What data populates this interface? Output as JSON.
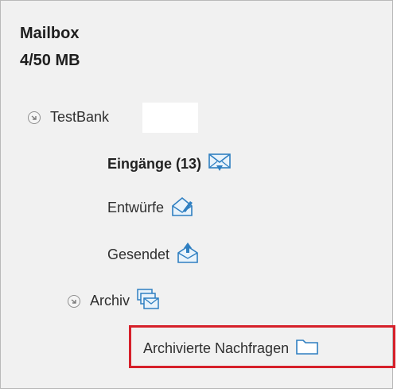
{
  "mailbox": {
    "title": "Mailbox",
    "size": "4/50 MB"
  },
  "tree": {
    "account": "TestBank",
    "folders": [
      {
        "label": "Eingänge (13)",
        "icon": "inbox-icon",
        "bold": true
      },
      {
        "label": "Entwürfe",
        "icon": "drafts-icon"
      },
      {
        "label": "Gesendet",
        "icon": "sent-icon"
      },
      {
        "label": "Archiv",
        "icon": "archive-icon"
      }
    ],
    "subfolder": {
      "label": "Archivierte Nachfragen",
      "icon": "folder-icon"
    }
  },
  "colors": {
    "highlight": "#d6202a",
    "icon_blue": "#2f7fc1",
    "background": "#f1f1f1"
  }
}
